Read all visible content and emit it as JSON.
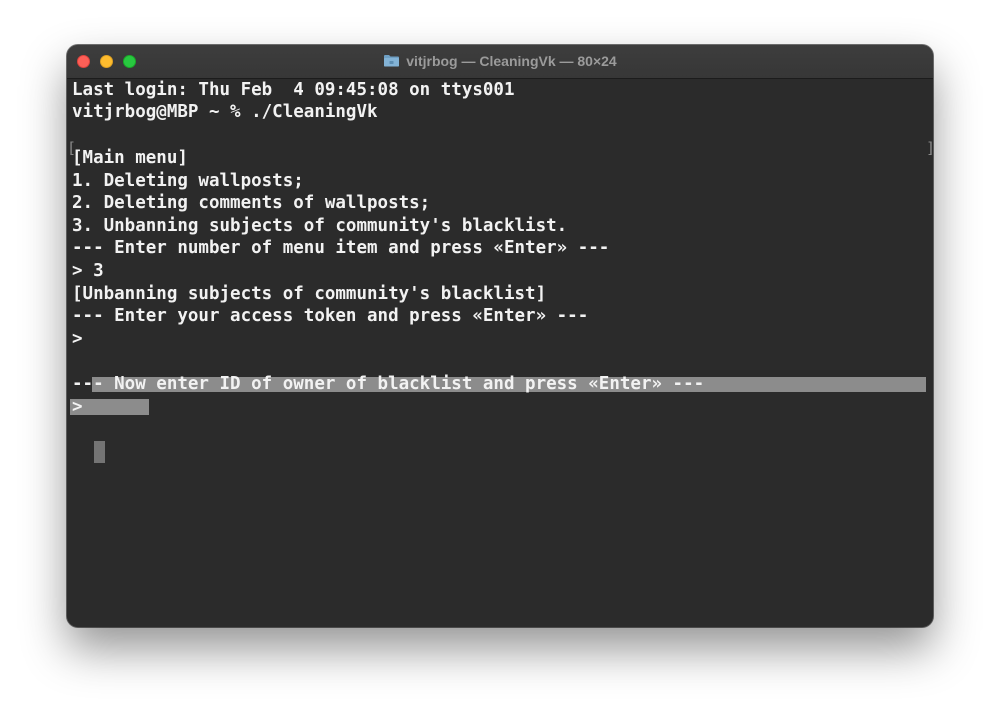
{
  "window": {
    "title": "vitjrbog — CleaningVk — 80×24",
    "title_icon": "folder-icon",
    "traffic_lights": [
      "close-button",
      "minimize-button",
      "zoom-button"
    ],
    "colors": {
      "close": "#fe5f57",
      "minimize": "#febc2e",
      "zoom": "#28c840",
      "background": "#2b2b2b",
      "text": "#f2f2f2"
    }
  },
  "terminal": {
    "last_login": "Last login: Thu Feb  4 09:45:08 on ttys001",
    "prompt_command": "vitjrbog@MBP ~ % ./CleaningVk",
    "main_menu_header": "[Main menu]",
    "menu_item_1": "1. Deleting wallposts;",
    "menu_item_2": "2. Deleting comments of wallposts;",
    "menu_item_3": "3. Unbanning subjects of community's blacklist.",
    "enter_menu_prompt": "--- Enter number of menu item and press «Enter» ---",
    "menu_input": "> 3",
    "unban_header": "[Unbanning subjects of community's blacklist]",
    "token_prompt": "--- Enter your access token and press «Enter» ---",
    "token_input_prefix": ">",
    "owner_id_prompt": "--- Now enter ID of owner of blacklist and press «Enter» ---",
    "current_prompt": ">"
  }
}
